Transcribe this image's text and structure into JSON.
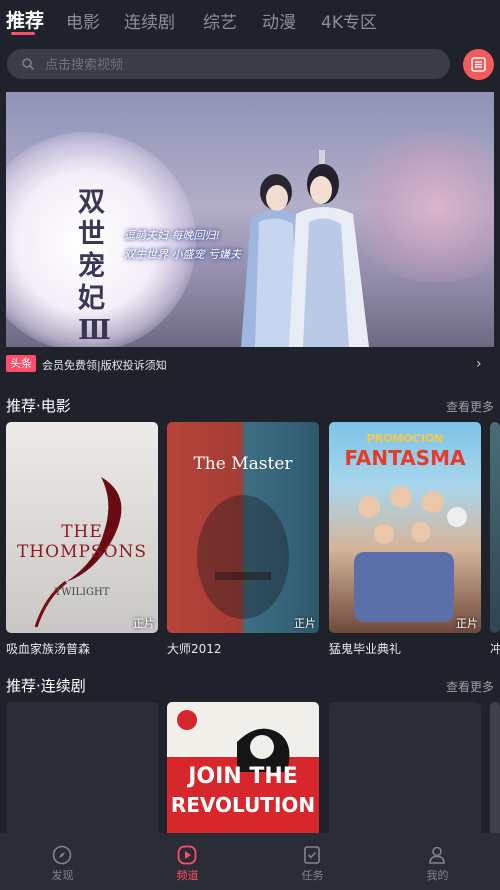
{
  "tabs": [
    {
      "label": "推荐"
    },
    {
      "label": "电影"
    },
    {
      "label": "连续剧"
    },
    {
      "label": "综艺"
    },
    {
      "label": "动漫"
    },
    {
      "label": "4K专区"
    }
  ],
  "search": {
    "placeholder": "点击搜索视频"
  },
  "banner": {
    "title_chars": [
      "双",
      "世",
      "宠",
      "妃",
      "Ⅲ"
    ],
    "tagline_1": "逗萌夫妇 每晚回归!",
    "tagline_2": "双生世界 小盛宠 亏嫌夫"
  },
  "news": {
    "badge": "头条",
    "text": "会员免费领|版权投诉须知"
  },
  "section_movies": {
    "title": "推荐·电影",
    "more": "查看更多",
    "items": [
      {
        "title": "吸血家族汤普森",
        "badge": "正片",
        "poster_text": "THE THOMPSONS",
        "poster_sub": "TWILIGHT"
      },
      {
        "title": "大师2012",
        "badge": "正片",
        "poster_text": "The Master"
      },
      {
        "title": "猛鬼毕业典礼",
        "badge": "正片",
        "poster_text_1": "PROMOCIÓN",
        "poster_text_2": "FANTASMA"
      },
      {
        "title": "冲"
      }
    ]
  },
  "section_series": {
    "title": "推荐·连续剧",
    "more": "查看更多",
    "poster_text_1": "JOIN THE",
    "poster_text_2": "REVOLUTION"
  },
  "bottom_nav": [
    {
      "label": "发现",
      "icon": "compass-icon"
    },
    {
      "label": "频道",
      "icon": "play-icon"
    },
    {
      "label": "任务",
      "icon": "task-icon"
    },
    {
      "label": "我的",
      "icon": "user-icon"
    }
  ],
  "colors": {
    "accent": "#ff4d6a",
    "background": "#20222b",
    "history_button": "#f25c5c"
  }
}
